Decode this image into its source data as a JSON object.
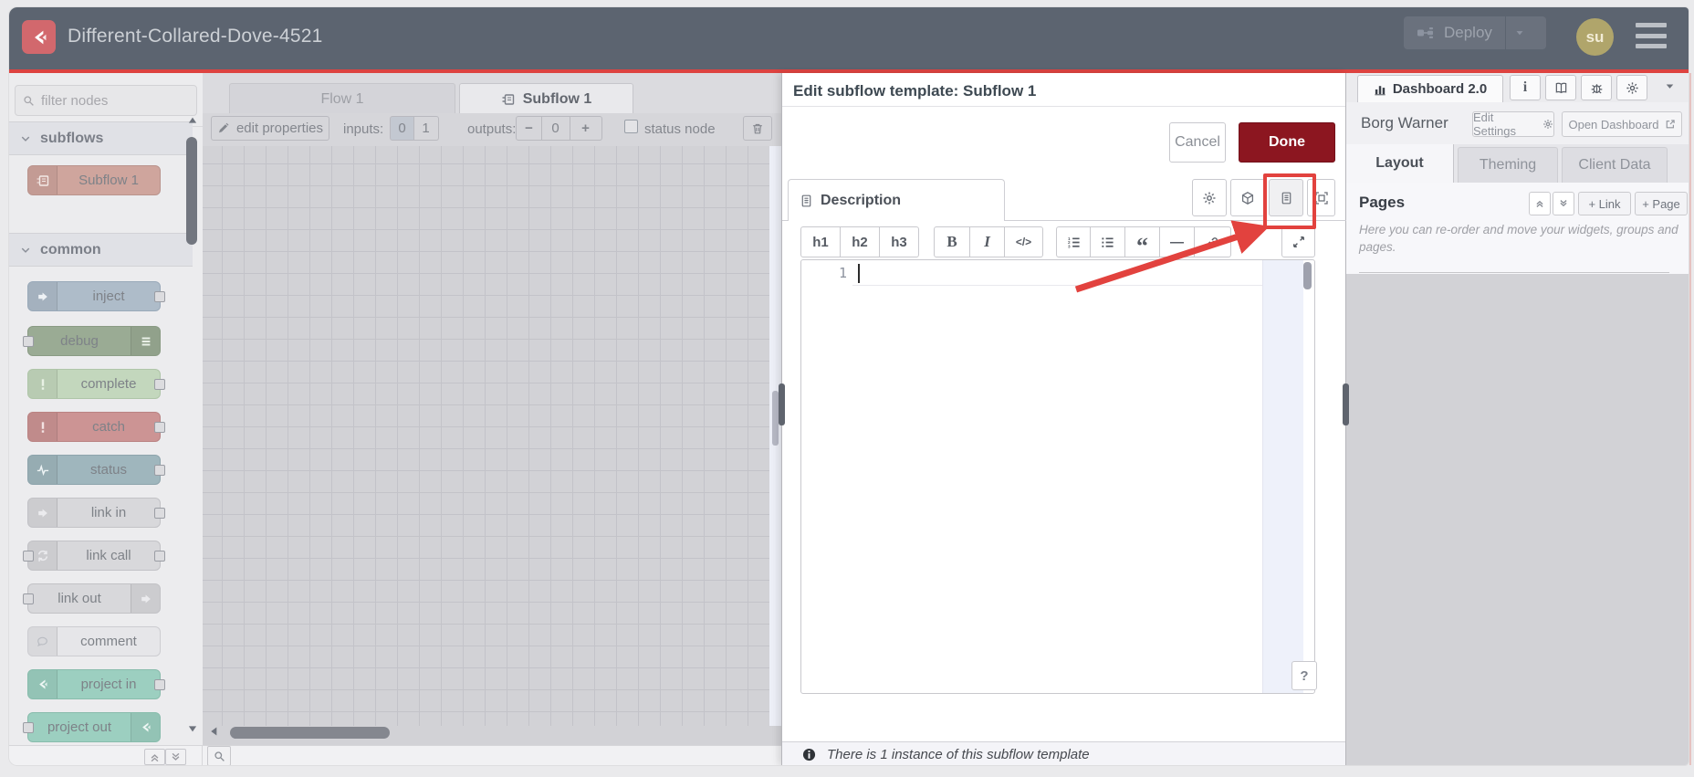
{
  "theme": {
    "header_bg": "#5c6470",
    "accent_red": "#dd4340",
    "annotation_red": "#e2423e",
    "done_red": "#8c1620",
    "logo_salmon": "#d2686d",
    "avatar_olive": "#b0a56b"
  },
  "header": {
    "title": "Different-Collared-Dove-4521",
    "deploy_label": "Deploy",
    "avatar_initials": "su"
  },
  "palette": {
    "filter_placeholder": "filter nodes",
    "sections": [
      {
        "label": "subflows",
        "items": [
          {
            "label": "Subflow 1",
            "color": "#cfa59d",
            "border": "#b9938c",
            "icon": "subflow-icon",
            "icon_color": "#f3e9e6",
            "icon_side": "left",
            "ports": "none"
          }
        ]
      },
      {
        "label": "common",
        "items": [
          {
            "label": "inject",
            "color": "#aebcc9",
            "border": "#99a9b9",
            "icon": "arrow-right-icon",
            "icon_color": "#eef2f5",
            "icon_side": "left",
            "ports": "right"
          },
          {
            "label": "debug",
            "color": "#9aab94",
            "border": "#8a9b84",
            "icon": "list-icon",
            "icon_color": "#e8efe6",
            "icon_side": "right",
            "ports": "left"
          },
          {
            "label": "complete",
            "color": "#c3d7bd",
            "border": "#afc5a8",
            "icon": "exclamation-icon",
            "icon_color": "#e9f2e5",
            "icon_side": "left",
            "ports": "right"
          },
          {
            "label": "catch",
            "color": "#cc9494",
            "border": "#ba8383",
            "icon": "exclamation-icon",
            "icon_color": "#f3e2e2",
            "icon_side": "left",
            "ports": "right"
          },
          {
            "label": "status",
            "color": "#9fb6bd",
            "border": "#8da4ac",
            "icon": "wave-icon",
            "icon_color": "#eef4f5",
            "icon_side": "left",
            "ports": "right"
          },
          {
            "label": "link in",
            "color": "#d8d8db",
            "border": "#c2c2c6",
            "icon": "arrow-right-icon",
            "icon_color": "#ebebee",
            "icon_side": "left",
            "ports": "right"
          },
          {
            "label": "link call",
            "color": "#d8d8db",
            "border": "#c2c2c6",
            "icon": "arrow-loop-icon",
            "icon_color": "#ebebee",
            "icon_side": "left",
            "ports": "both"
          },
          {
            "label": "link out",
            "color": "#d8d8db",
            "border": "#c2c2c6",
            "icon": "arrow-right-icon",
            "icon_color": "#ebebee",
            "icon_side": "right",
            "ports": "left"
          },
          {
            "label": "comment",
            "color": "#e6e6e9",
            "border": "#cdcdd1",
            "icon": "bubble-icon",
            "icon_color": "#b9bcc2",
            "icon_side": "left",
            "ports": "none"
          },
          {
            "label": "project in",
            "color": "#9ccfc0",
            "border": "#88bcac",
            "icon": "node-red-icon",
            "icon_color": "#eef7f4",
            "icon_side": "left",
            "ports": "right"
          },
          {
            "label": "project out",
            "color": "#9ccfc0",
            "border": "#88bcac",
            "icon": "node-red-icon",
            "icon_color": "#eef7f4",
            "icon_side": "right",
            "ports": "left"
          }
        ]
      }
    ]
  },
  "workspace": {
    "tabs": [
      {
        "label": "Flow 1",
        "active": false
      },
      {
        "label": "Subflow 1",
        "active": true
      }
    ],
    "toolbar": {
      "edit_properties_label": "edit properties",
      "inputs_label": "inputs:",
      "inputs_options": [
        "0",
        "1"
      ],
      "inputs_selected": "0",
      "outputs_label": "outputs:",
      "outputs_minus": "−",
      "outputs_value": "0",
      "outputs_plus": "+",
      "status_node_label": "status node",
      "status_checked": false
    }
  },
  "dialog": {
    "title": "Edit subflow template: Subflow 1",
    "cancel_label": "Cancel",
    "done_label": "Done",
    "tab_label": "Description",
    "toolbar_icons": [
      "gear-icon",
      "cube-icon",
      "document-icon",
      "frame-icon"
    ],
    "md_toolbar": {
      "h1": "h1",
      "h2": "h2",
      "h3": "h3",
      "bold": "B",
      "italic": "I",
      "code": "</>",
      "hr": "—",
      "quote": "“"
    },
    "editor": {
      "line_number": "1",
      "content": ""
    },
    "help_label": "?",
    "footer_text": "There is 1 instance of this subflow template"
  },
  "sidebar": {
    "tab_label": "Dashboard 2.0",
    "project_name": "Borg Warner",
    "edit_settings_label": "Edit Settings",
    "open_dashboard_label": "Open Dashboard",
    "tabs": [
      "Layout",
      "Theming",
      "Client Data"
    ],
    "active_tab": "Layout",
    "pages": {
      "title": "Pages",
      "link_button": "+ Link",
      "page_button": "+ Page",
      "help_text": "Here you can re-order and move your widgets, groups and pages."
    }
  },
  "annotation": {
    "color": "#e2423e",
    "shape": "box-and-arrow",
    "target": "description-toolbar-button"
  }
}
